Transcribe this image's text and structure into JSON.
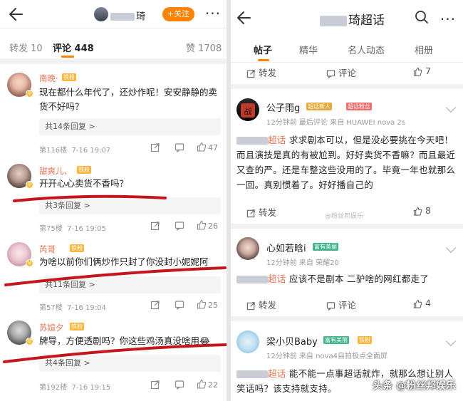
{
  "left": {
    "header": {
      "title": "琦",
      "follow_label": "+关注"
    },
    "tabs": {
      "repost": "转发 10",
      "comments": "评论 448",
      "likes": "赞 1708"
    },
    "comments": [
      {
        "name": "南晚·",
        "badge": "铁粉",
        "text": "现在都什么年代了，还炒作呢！安安静静的卖货不好吗？",
        "replies": "共14条回复 >",
        "floor": "第116楼",
        "date": "7-16",
        "time": "19:07",
        "likes": "47"
      },
      {
        "name": "甜爽儿、",
        "badge": "铁粉",
        "text": "开开心心卖货不香吗？",
        "replies": "共3条回复 >",
        "floor": "第75楼",
        "date": "7-16",
        "time": "19:05",
        "likes": "26"
      },
      {
        "name": "芮哥",
        "badge": "铁粉",
        "text": "为啥以前你们俩炒作只封了你没封小妮妮阿",
        "replies": "共11条回复 >",
        "floor": "第57楼",
        "date": "7-16",
        "time": "19:04",
        "likes": "25"
      },
      {
        "name": "苏媗夕",
        "badge": "铁粉",
        "text": "牌导，方便透剧吗？你这些鸡汤真没啥用😂",
        "replies": "共4条回复 >",
        "floor": "第192楼",
        "date": "7-16",
        "time": "19:15",
        "likes": "22"
      }
    ]
  },
  "right": {
    "header": {
      "title": "琦超话"
    },
    "tabs": [
      "帖子",
      "精华",
      "名人动态",
      "相册"
    ],
    "first_actions": {
      "repost": "转发",
      "comment": "评论",
      "likes": "7"
    },
    "posts": [
      {
        "name": "公子雨g",
        "badge1": "超话新人",
        "badge2": "超话粉丝",
        "meta": "12分钟前  最后评论    来自 HUAWEI nova 2s",
        "tag": "超话",
        "text": "求求剧本可以，但是没必要挑在今天吧！而且演技是真的有被尬到。好好卖货不香嘛？而且最近又查的严。还是车整这些没用的了。毕竟一年也就那么一回。真别惯着了。好好播自己的",
        "repost": "转发",
        "likes": "8"
      },
      {
        "name": "心如若晗i",
        "badge1": "富有美丽",
        "badge2": "",
        "meta": "12分钟前    来自 荣耀20",
        "tag": "超话",
        "text": "应该不是剧本 二驴啥的网红都走了",
        "repost": "转发",
        "comment": "评论",
        "likes": "4"
      },
      {
        "name": "梁小贝Baby",
        "badge1": "富有美丽",
        "badge2": "铁粉",
        "meta": "12分钟前    来自 nova4自拍极点全面屏",
        "tag": "超话",
        "text": "能不能一点事超话就炸，就那么想让别人笑话吗？该支持就支持。"
      }
    ],
    "watermark": "头条 @粉丝邦娱乐"
  },
  "colors": {
    "accent": "#ff8200",
    "name_orange": "#eb7350",
    "annotation_red": "#c4161c"
  }
}
